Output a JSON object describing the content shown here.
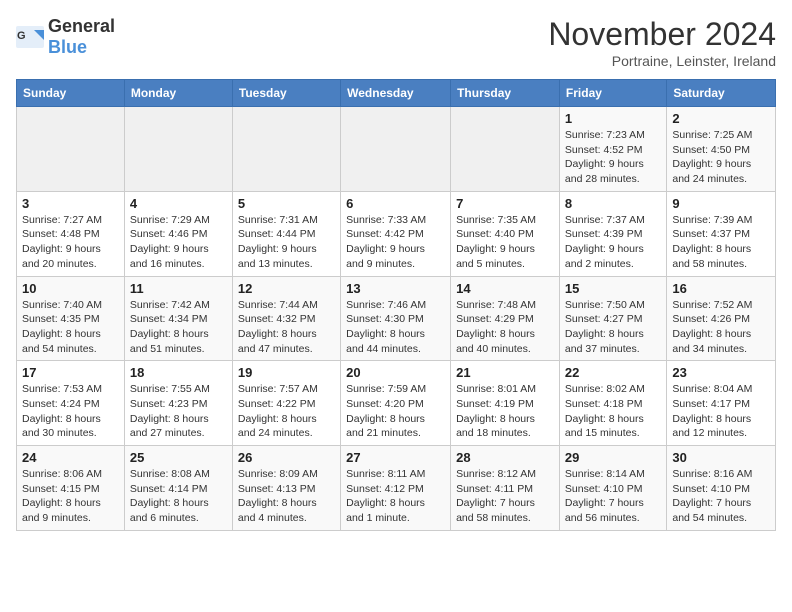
{
  "header": {
    "logo_general": "General",
    "logo_blue": "Blue",
    "title": "November 2024",
    "subtitle": "Portraine, Leinster, Ireland"
  },
  "weekdays": [
    "Sunday",
    "Monday",
    "Tuesday",
    "Wednesday",
    "Thursday",
    "Friday",
    "Saturday"
  ],
  "weeks": [
    [
      {
        "day": "",
        "info": ""
      },
      {
        "day": "",
        "info": ""
      },
      {
        "day": "",
        "info": ""
      },
      {
        "day": "",
        "info": ""
      },
      {
        "day": "",
        "info": ""
      },
      {
        "day": "1",
        "info": "Sunrise: 7:23 AM\nSunset: 4:52 PM\nDaylight: 9 hours and 28 minutes."
      },
      {
        "day": "2",
        "info": "Sunrise: 7:25 AM\nSunset: 4:50 PM\nDaylight: 9 hours and 24 minutes."
      }
    ],
    [
      {
        "day": "3",
        "info": "Sunrise: 7:27 AM\nSunset: 4:48 PM\nDaylight: 9 hours and 20 minutes."
      },
      {
        "day": "4",
        "info": "Sunrise: 7:29 AM\nSunset: 4:46 PM\nDaylight: 9 hours and 16 minutes."
      },
      {
        "day": "5",
        "info": "Sunrise: 7:31 AM\nSunset: 4:44 PM\nDaylight: 9 hours and 13 minutes."
      },
      {
        "day": "6",
        "info": "Sunrise: 7:33 AM\nSunset: 4:42 PM\nDaylight: 9 hours and 9 minutes."
      },
      {
        "day": "7",
        "info": "Sunrise: 7:35 AM\nSunset: 4:40 PM\nDaylight: 9 hours and 5 minutes."
      },
      {
        "day": "8",
        "info": "Sunrise: 7:37 AM\nSunset: 4:39 PM\nDaylight: 9 hours and 2 minutes."
      },
      {
        "day": "9",
        "info": "Sunrise: 7:39 AM\nSunset: 4:37 PM\nDaylight: 8 hours and 58 minutes."
      }
    ],
    [
      {
        "day": "10",
        "info": "Sunrise: 7:40 AM\nSunset: 4:35 PM\nDaylight: 8 hours and 54 minutes."
      },
      {
        "day": "11",
        "info": "Sunrise: 7:42 AM\nSunset: 4:34 PM\nDaylight: 8 hours and 51 minutes."
      },
      {
        "day": "12",
        "info": "Sunrise: 7:44 AM\nSunset: 4:32 PM\nDaylight: 8 hours and 47 minutes."
      },
      {
        "day": "13",
        "info": "Sunrise: 7:46 AM\nSunset: 4:30 PM\nDaylight: 8 hours and 44 minutes."
      },
      {
        "day": "14",
        "info": "Sunrise: 7:48 AM\nSunset: 4:29 PM\nDaylight: 8 hours and 40 minutes."
      },
      {
        "day": "15",
        "info": "Sunrise: 7:50 AM\nSunset: 4:27 PM\nDaylight: 8 hours and 37 minutes."
      },
      {
        "day": "16",
        "info": "Sunrise: 7:52 AM\nSunset: 4:26 PM\nDaylight: 8 hours and 34 minutes."
      }
    ],
    [
      {
        "day": "17",
        "info": "Sunrise: 7:53 AM\nSunset: 4:24 PM\nDaylight: 8 hours and 30 minutes."
      },
      {
        "day": "18",
        "info": "Sunrise: 7:55 AM\nSunset: 4:23 PM\nDaylight: 8 hours and 27 minutes."
      },
      {
        "day": "19",
        "info": "Sunrise: 7:57 AM\nSunset: 4:22 PM\nDaylight: 8 hours and 24 minutes."
      },
      {
        "day": "20",
        "info": "Sunrise: 7:59 AM\nSunset: 4:20 PM\nDaylight: 8 hours and 21 minutes."
      },
      {
        "day": "21",
        "info": "Sunrise: 8:01 AM\nSunset: 4:19 PM\nDaylight: 8 hours and 18 minutes."
      },
      {
        "day": "22",
        "info": "Sunrise: 8:02 AM\nSunset: 4:18 PM\nDaylight: 8 hours and 15 minutes."
      },
      {
        "day": "23",
        "info": "Sunrise: 8:04 AM\nSunset: 4:17 PM\nDaylight: 8 hours and 12 minutes."
      }
    ],
    [
      {
        "day": "24",
        "info": "Sunrise: 8:06 AM\nSunset: 4:15 PM\nDaylight: 8 hours and 9 minutes."
      },
      {
        "day": "25",
        "info": "Sunrise: 8:08 AM\nSunset: 4:14 PM\nDaylight: 8 hours and 6 minutes."
      },
      {
        "day": "26",
        "info": "Sunrise: 8:09 AM\nSunset: 4:13 PM\nDaylight: 8 hours and 4 minutes."
      },
      {
        "day": "27",
        "info": "Sunrise: 8:11 AM\nSunset: 4:12 PM\nDaylight: 8 hours and 1 minute."
      },
      {
        "day": "28",
        "info": "Sunrise: 8:12 AM\nSunset: 4:11 PM\nDaylight: 7 hours and 58 minutes."
      },
      {
        "day": "29",
        "info": "Sunrise: 8:14 AM\nSunset: 4:10 PM\nDaylight: 7 hours and 56 minutes."
      },
      {
        "day": "30",
        "info": "Sunrise: 8:16 AM\nSunset: 4:10 PM\nDaylight: 7 hours and 54 minutes."
      }
    ]
  ]
}
